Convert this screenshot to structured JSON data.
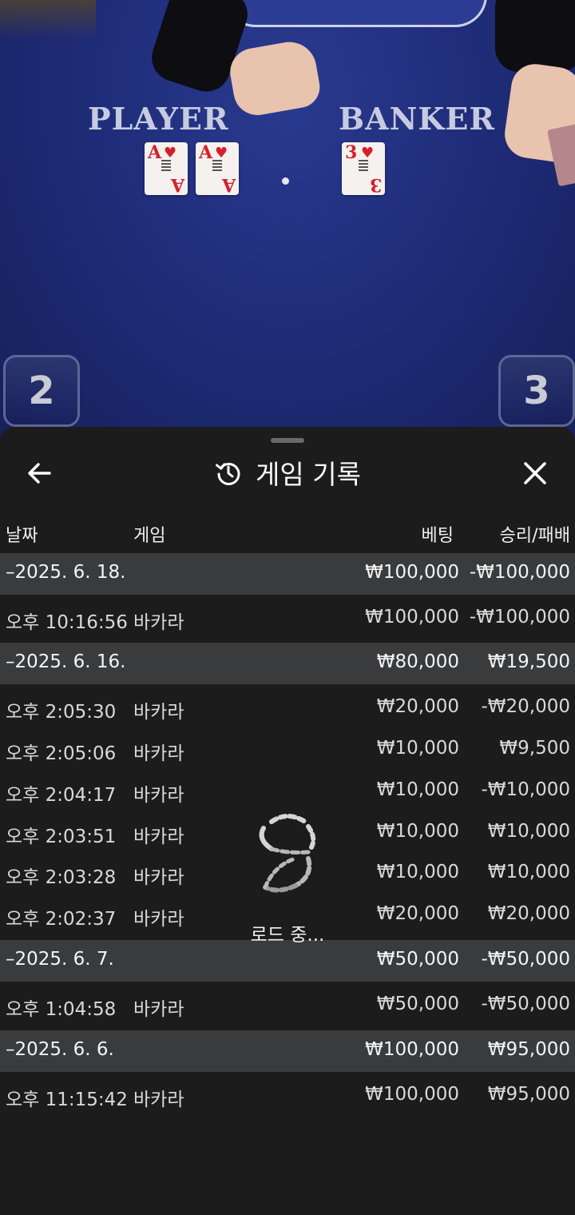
{
  "table": {
    "player_label": "PLAYER",
    "banker_label": "BANKER",
    "player_cards": [
      {
        "rank": "A",
        "suit": "♥"
      },
      {
        "rank": "A",
        "suit": "♥"
      }
    ],
    "banker_cards": [
      {
        "rank": "3",
        "suit": "♥"
      }
    ],
    "player_score": "2",
    "banker_score": "3"
  },
  "sheet": {
    "title": "게임 기록",
    "icons": {
      "back": "back-arrow-icon",
      "history": "history-icon",
      "close": "close-icon"
    },
    "columns": {
      "date": "날짜",
      "game": "게임",
      "bet": "베팅",
      "result": "승리/패배"
    },
    "rows": [
      {
        "type": "group",
        "date": "–2025. 6. 18.",
        "game": "",
        "bet": "₩100,000",
        "result": "-₩100,000"
      },
      {
        "type": "item",
        "date": "오후 10:16:56",
        "game": "바카라",
        "bet": "₩100,000",
        "result": "-₩100,000"
      },
      {
        "type": "group",
        "date": "–2025. 6. 16.",
        "game": "",
        "bet": "₩80,000",
        "result": "₩19,500"
      },
      {
        "type": "item",
        "date": "오후 2:05:30",
        "game": "바카라",
        "bet": "₩20,000",
        "result": "-₩20,000"
      },
      {
        "type": "item",
        "date": "오후 2:05:06",
        "game": "바카라",
        "bet": "₩10,000",
        "result": "₩9,500"
      },
      {
        "type": "item",
        "date": "오후 2:04:17",
        "game": "바카라",
        "bet": "₩10,000",
        "result": "-₩10,000"
      },
      {
        "type": "item",
        "date": "오후 2:03:51",
        "game": "바카라",
        "bet": "₩10,000",
        "result": "₩10,000"
      },
      {
        "type": "item",
        "date": "오후 2:03:28",
        "game": "바카라",
        "bet": "₩10,000",
        "result": "₩10,000"
      },
      {
        "type": "item",
        "date": "오후 2:02:37",
        "game": "바카라",
        "bet": "₩20,000",
        "result": "₩20,000"
      },
      {
        "type": "group",
        "date": "–2025. 6. 7.",
        "game": "",
        "bet": "₩50,000",
        "result": "-₩50,000"
      },
      {
        "type": "item",
        "date": "오후 1:04:58",
        "game": "바카라",
        "bet": "₩50,000",
        "result": "-₩50,000"
      },
      {
        "type": "group",
        "date": "–2025. 6. 6.",
        "game": "",
        "bet": "₩100,000",
        "result": "₩95,000"
      },
      {
        "type": "item",
        "date": "오후 11:15:42",
        "game": "바카라",
        "bet": "₩100,000",
        "result": "₩95,000"
      }
    ],
    "loading_text": "로드 중..."
  }
}
